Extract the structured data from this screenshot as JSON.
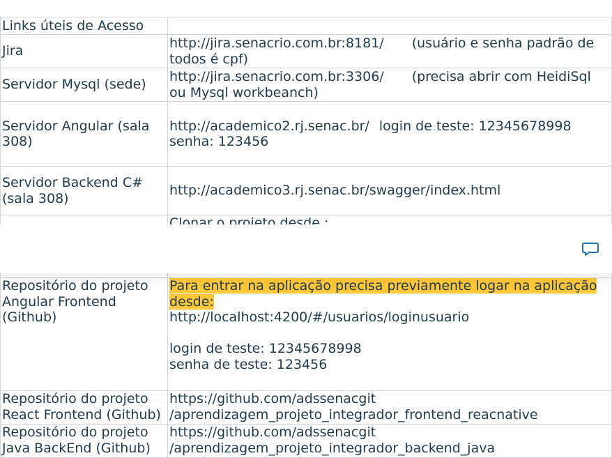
{
  "table": {
    "header": {
      "label": "Links úteis de Acesso",
      "value": ""
    },
    "rows": [
      {
        "label": "Jira",
        "url": "http://jira.senacrio.com.br:8181/",
        "note": "(usuário e senha padrão de todos é cpf)"
      },
      {
        "label": "Servidor Mysql (sede)",
        "url": "http://jira.senacrio.com.br:3306/",
        "note": "(precisa abrir com HeidiSql ou Mysql workbeanch)"
      },
      {
        "label": "Servidor Angular (sala 308)",
        "url": "http://academico2.rj.senac.br/",
        "note": "login de teste: 12345678998",
        "note2": "senha: 123456"
      },
      {
        "label": "Servidor Backend C# (sala 308)",
        "url": "http://academico3.rj.senac.br/swagger/index.html"
      },
      {
        "label": "",
        "text": "Clonar o projeto desde :"
      },
      {
        "label": "Repositório do projeto Angular Frontend (Github)",
        "highlight": "Para entrar na aplicação precisa previamente logar na aplicação desde:",
        "url": "http://localhost:4200/#/usuarios/loginusuario",
        "login": "login de teste: 12345678998",
        "password": "senha de teste: 123456"
      },
      {
        "label": "Repositório do projeto React Frontend (Github)",
        "url_a": "https://github.com/adssenacgit",
        "url_b": "/aprendizagem_projeto_integrador_frontend_reacnative"
      },
      {
        "label": "Repositório do projeto Java BackEnd (Github)",
        "url_a": "https://github.com/adssenacgit",
        "url_b": "/aprendizagem_projeto_integrador_backend_java"
      }
    ]
  },
  "toolbar": {
    "comment_icon": "comment-icon",
    "accent": "#1a73b5"
  },
  "colors": {
    "text": "#1f3b4d",
    "highlight": "#ffc839",
    "border": "#d0d5da"
  }
}
